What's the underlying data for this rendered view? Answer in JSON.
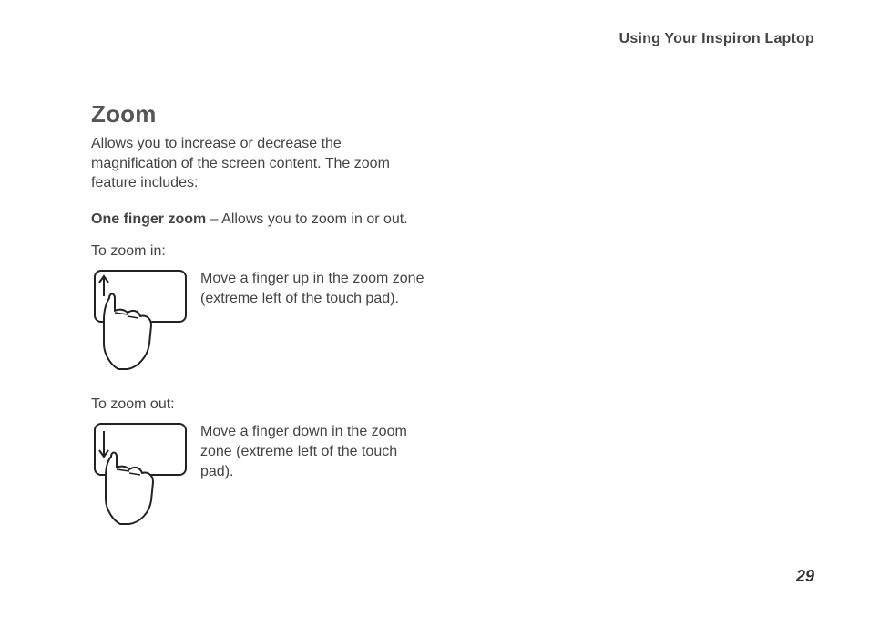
{
  "header": {
    "running_head": "Using Your Inspiron Laptop"
  },
  "section": {
    "title": "Zoom",
    "intro": "Allows you to increase or decrease the magnification of the screen content. The zoom feature includes:",
    "feature_bold": "One finger zoom",
    "feature_rest": " – Allows you to zoom in or out.",
    "zoom_in_label": "To zoom in:",
    "zoom_in_text": "Move a finger up in the zoom zone (extreme left of the touch pad).",
    "zoom_out_label": "To zoom out:",
    "zoom_out_text": "Move a finger down in the zoom zone (extreme left of the touch pad)."
  },
  "page_number": "29"
}
